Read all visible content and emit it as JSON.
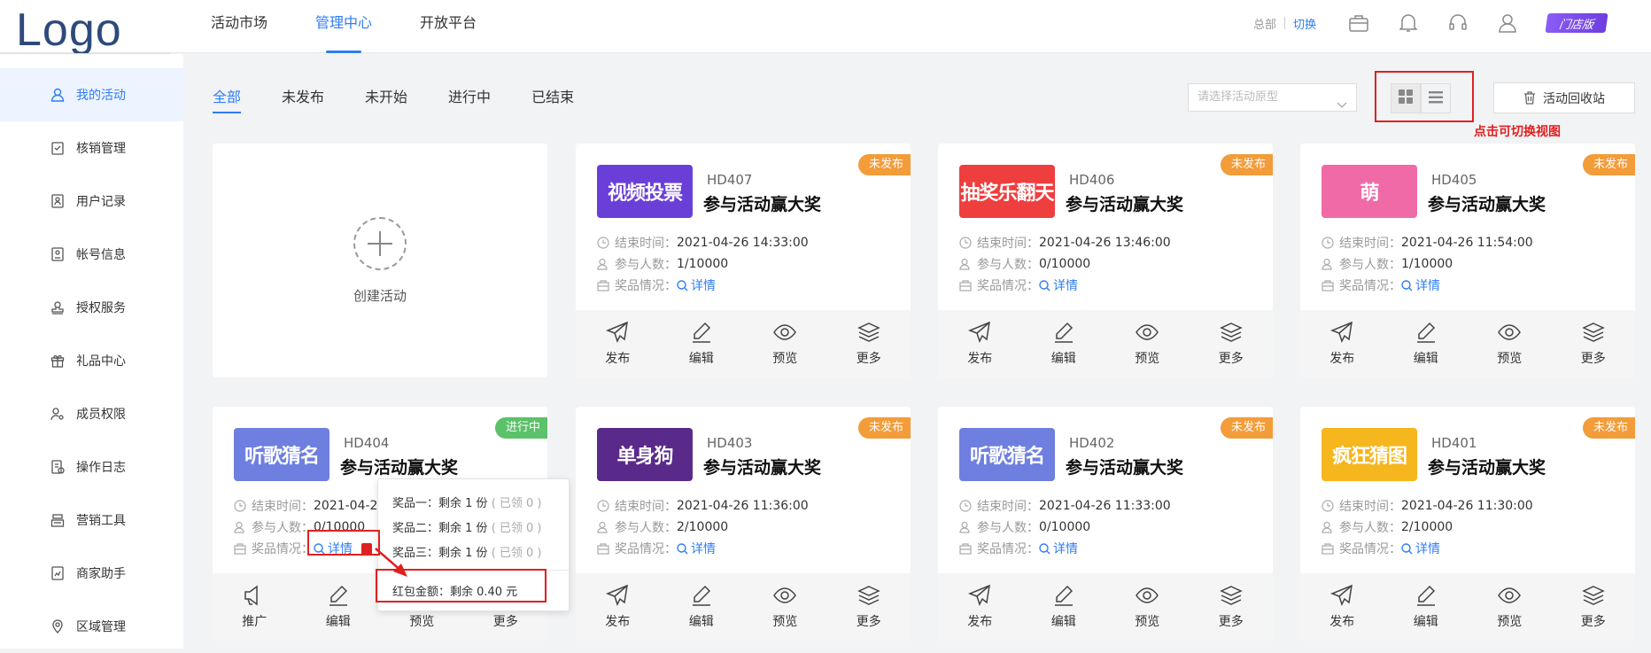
{
  "header": {
    "logo": "Logo",
    "nav": [
      "活动市场",
      "管理中心",
      "开放平台"
    ],
    "active_nav": 1,
    "hq_label": "总部",
    "switch_label": "切换",
    "store_badge": "门店版"
  },
  "sidebar": {
    "items": [
      {
        "label": "我的活动",
        "icon": "user-icon"
      },
      {
        "label": "核销管理",
        "icon": "check-clipboard-icon"
      },
      {
        "label": "用户记录",
        "icon": "user-record-icon"
      },
      {
        "label": "帐号信息",
        "icon": "account-card-icon"
      },
      {
        "label": "授权服务",
        "icon": "stamp-icon"
      },
      {
        "label": "礼品中心",
        "icon": "gift-icon"
      },
      {
        "label": "成员权限",
        "icon": "member-permission-icon"
      },
      {
        "label": "操作日志",
        "icon": "log-icon"
      },
      {
        "label": "营销工具",
        "icon": "cash-register-icon"
      },
      {
        "label": "商家助手",
        "icon": "chart-doc-icon"
      },
      {
        "label": "区域管理",
        "icon": "location-pin-icon"
      }
    ]
  },
  "tabs": [
    "全部",
    "未发布",
    "未开始",
    "进行中",
    "已结束"
  ],
  "filter": {
    "placeholder": "请选择活动原型",
    "recycle_label": "活动回收站",
    "view_hint": "点击可切换视图"
  },
  "create_label": "创建活动",
  "labels": {
    "end_time": "结束时间：",
    "participants": "参与人数：",
    "prizes": "奖品情况：",
    "detail": "详情"
  },
  "cards": [
    {
      "code": "HD407",
      "title": "参与活动赢大奖",
      "status": "未发布",
      "thumb_text": "视频投票",
      "thumb_bg": "#6a3fd8",
      "end_time": "2021-04-26 14:33:00",
      "participants": "1/10000",
      "actions": [
        "发布",
        "编辑",
        "预览",
        "更多"
      ]
    },
    {
      "code": "HD406",
      "title": "参与活动赢大奖",
      "status": "未发布",
      "thumb_text": "抽奖乐翻天",
      "thumb_bg": "#ef3e3e",
      "end_time": "2021-04-26 13:46:00",
      "participants": "0/10000",
      "actions": [
        "发布",
        "编辑",
        "预览",
        "更多"
      ]
    },
    {
      "code": "HD405",
      "title": "参与活动赢大奖",
      "status": "未发布",
      "thumb_text": "萌",
      "thumb_bg": "#f06aa8",
      "end_time": "2021-04-26 11:54:00",
      "participants": "1/10000",
      "actions": [
        "发布",
        "编辑",
        "预览",
        "更多"
      ]
    },
    {
      "code": "HD404",
      "title": "参与活动赢大奖",
      "status": "进行中",
      "thumb_text": "听歌猜名",
      "thumb_bg": "#6f7fe0",
      "end_time": "2021-04-2",
      "participants": "0/10000",
      "actions": [
        "推广",
        "编辑",
        "预览",
        "更多"
      ]
    },
    {
      "code": "HD403",
      "title": "参与活动赢大奖",
      "status": "未发布",
      "thumb_text": "单身狗",
      "thumb_bg": "#5a2a8a",
      "end_time": "2021-04-26 11:36:00",
      "participants": "2/10000",
      "actions": [
        "发布",
        "编辑",
        "预览",
        "更多"
      ]
    },
    {
      "code": "HD402",
      "title": "参与活动赢大奖",
      "status": "未发布",
      "thumb_text": "听歌猜名",
      "thumb_bg": "#6f7fe0",
      "end_time": "2021-04-26 11:33:00",
      "participants": "0/10000",
      "actions": [
        "发布",
        "编辑",
        "预览",
        "更多"
      ]
    },
    {
      "code": "HD401",
      "title": "参与活动赢大奖",
      "status": "未发布",
      "thumb_text": "疯狂猜图",
      "thumb_bg": "#f5b61e",
      "end_time": "2021-04-26 11:30:00",
      "participants": "2/10000",
      "actions": [
        "发布",
        "编辑",
        "预览",
        "更多"
      ]
    }
  ],
  "popup": {
    "rows": [
      {
        "text": "奖品一：剩余 1 份",
        "dim": "( 已领 0 )"
      },
      {
        "text": "奖品二：剩余 1 份",
        "dim": "( 已领 0 )"
      },
      {
        "text": "奖品三：剩余 1 份",
        "dim": "( 已领 0 )"
      }
    ],
    "red_packet": "红包金额：剩余 0.40 元"
  },
  "colors": {
    "accent": "#2f7df6",
    "unpublished": "#f39c3a",
    "live": "#5bc16a",
    "annotation": "#e02020"
  }
}
